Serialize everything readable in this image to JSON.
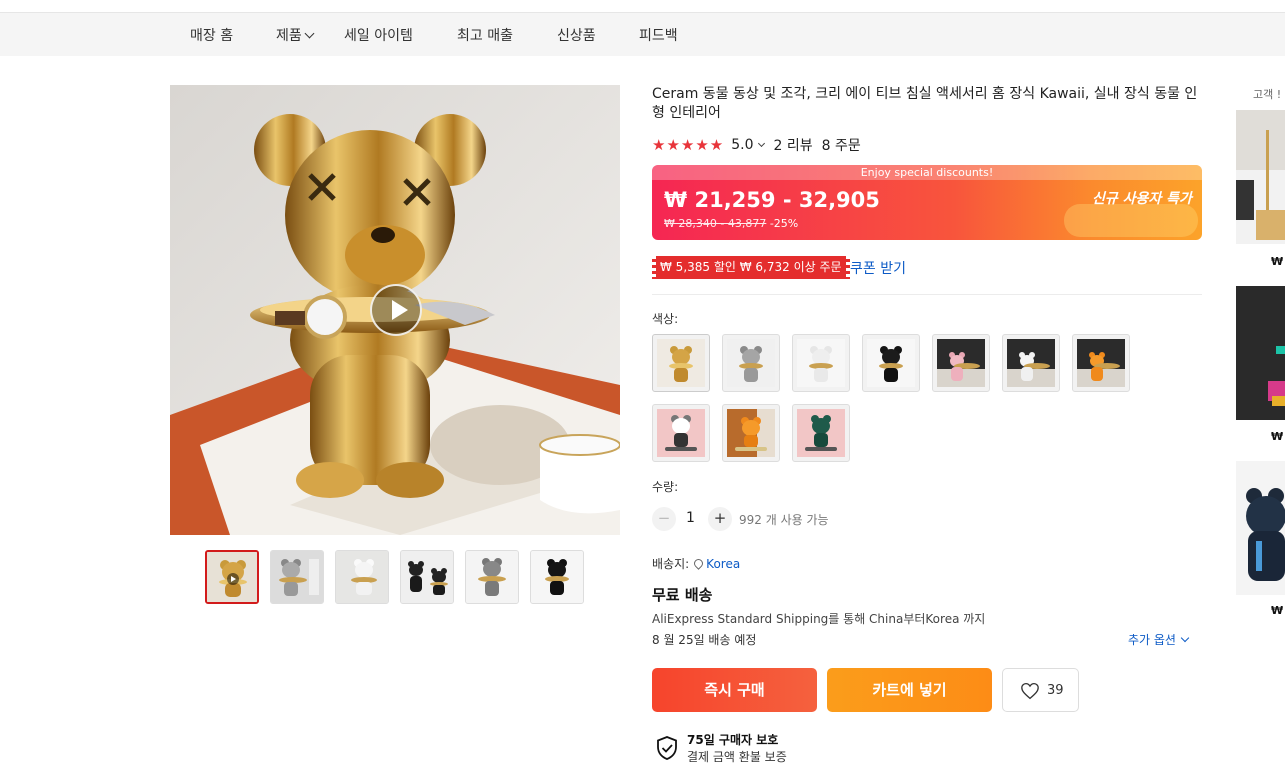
{
  "nav": {
    "items": [
      "매장 홈",
      "제품",
      "세일 아이템",
      "최고 매출",
      "신상품",
      "피드백"
    ]
  },
  "product": {
    "title": "Ceram 동물 동상 및 조각, 크리 에이 티브 침실 액세서리 홈 장식 Kawaii, 실내 장식 동물 인형 인테리어",
    "rating": "5.0",
    "reviews": "2 리뷰",
    "orders": "8 주문",
    "star_glyphs": "★★★★★"
  },
  "price": {
    "banner": "Enjoy special discounts!",
    "current": "₩ 21,259 - 32,905",
    "original": "₩ 28,340 - 43,877",
    "discount": "-25%",
    "new_user": "신규 사용자 특가"
  },
  "coupon": {
    "tag": "₩ 5,385 할인 ₩ 6,732 이상 주문",
    "link": "쿠폰 받기"
  },
  "color": {
    "label": "색상:",
    "swatch_count": 10
  },
  "quantity": {
    "label": "수량:",
    "value": "1",
    "minus": "−",
    "plus": "+",
    "available": "992 개 사용 가능"
  },
  "shipping": {
    "label": "배송지:",
    "country": "Korea",
    "free": "무료 배송",
    "desc": "AliExpress Standard Shipping를 통해 China부터Korea 까지",
    "eta": "8 월 25일 배송 예정",
    "more": "추가 옵션"
  },
  "actions": {
    "buy": "즉시 구매",
    "cart": "카트에 넣기",
    "wish_count": "39"
  },
  "protection": {
    "title": "75일 구매자 보호",
    "desc": "결제 금액 환불 보증"
  },
  "sidebar": {
    "heading": "고객 !",
    "price_glyph": "₩"
  },
  "colors": {
    "price_gradient_start": "#f52653",
    "price_gradient_end": "#fca32a",
    "buy": "#f6442c",
    "cart": "#fb9d1b",
    "link": "#0d5bc6",
    "star": "#e8343a"
  }
}
